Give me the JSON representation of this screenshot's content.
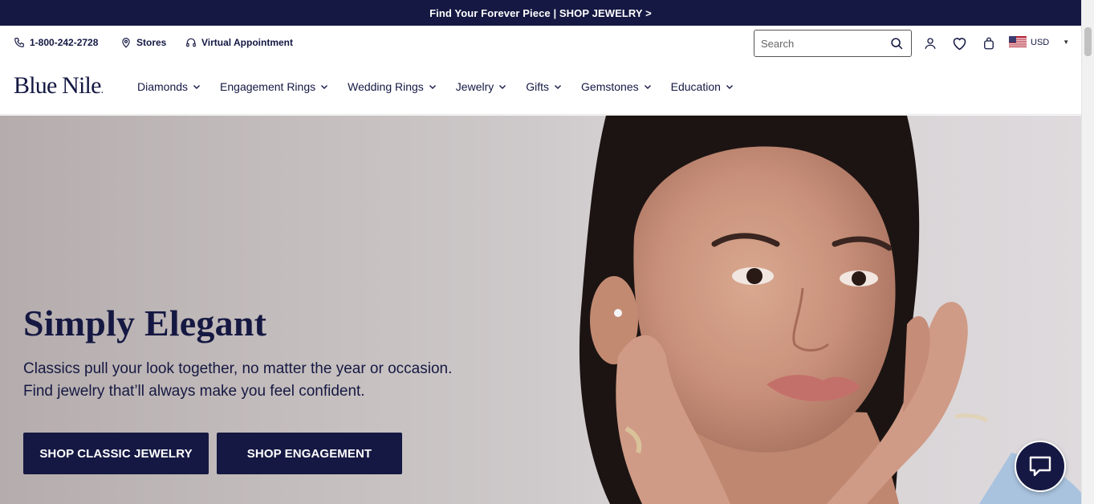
{
  "promo": {
    "text": "Find Your Forever Piece | SHOP JEWELRY >"
  },
  "utility": {
    "phone": "1-800-242-2728",
    "stores": "Stores",
    "virtual_appointment": "Virtual Appointment",
    "search_placeholder": "Search",
    "currency": "USD"
  },
  "logo": {
    "text": "Blue Nile",
    "mark": "."
  },
  "nav": {
    "items": [
      {
        "label": "Diamonds"
      },
      {
        "label": "Engagement Rings"
      },
      {
        "label": "Wedding Rings"
      },
      {
        "label": "Jewelry"
      },
      {
        "label": "Gifts"
      },
      {
        "label": "Gemstones"
      },
      {
        "label": "Education"
      }
    ]
  },
  "hero": {
    "title": "Simply Elegant",
    "subtitle_line1": "Classics pull your look together, no matter the year or occasion.",
    "subtitle_line2": "Find jewelry that’ll always make you feel confident.",
    "cta_primary": "SHOP CLASSIC JEWELRY",
    "cta_secondary": "SHOP ENGAGEMENT"
  },
  "icons": {
    "phone": "phone-icon",
    "stores": "map-pin-icon",
    "appointment": "headset-icon",
    "search": "search-icon",
    "account": "user-icon",
    "wishlist": "heart-icon",
    "bag": "shopping-bag-icon",
    "chat": "chat-icon"
  },
  "colors": {
    "brand_navy": "#151842",
    "text": "#141843"
  }
}
